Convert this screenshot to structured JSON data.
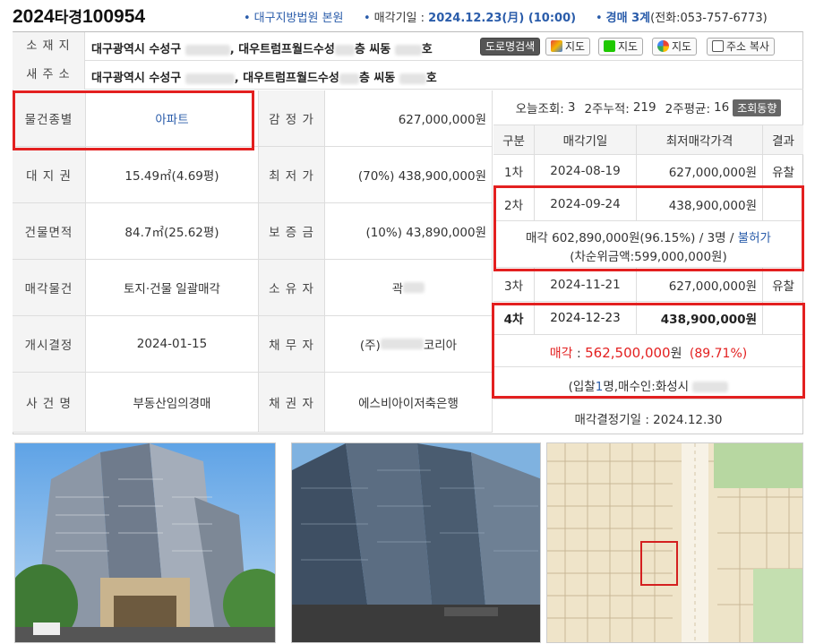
{
  "header": {
    "case_year": "2024",
    "case_kind": "타경",
    "case_num": "100954",
    "court": "대구지방법원 본원",
    "sale_date_label": "매각기일 : ",
    "sale_date": "2024.12.23(月) (10:00)",
    "dept": "경매 3계",
    "phone": "(전화:053-757-6773)"
  },
  "address": {
    "location_label": "소 재 지",
    "location_part1": "대구광역시 수성구",
    "location_part2": ", 대우트럼프월드수성",
    "location_part3": "층 씨동",
    "location_part4": "호",
    "new_label": "새 주 소",
    "new_part1": "대구광역시 수성구",
    "new_part2": ", 대우트럼프월드수성",
    "new_part3": "층 씨동",
    "new_part4": "호",
    "buttons": {
      "road": "도로명검색",
      "daum": "지도",
      "naver": "지도",
      "google": "지도",
      "copy": "주소 복사"
    }
  },
  "info": {
    "type_label": "물건종별",
    "type_value": "아파트",
    "appraisal_label": "감 정 가",
    "appraisal_value": "627,000,000원",
    "land_label": "대 지 권",
    "land_value": "15.49㎡(4.69평)",
    "min_label": "최 저 가",
    "min_value": "(70%) 438,900,000원",
    "area_label": "건물면적",
    "area_value": "84.7㎡(25.62평)",
    "deposit_label": "보 증 금",
    "deposit_value": "(10%) 43,890,000원",
    "item_label": "매각물건",
    "item_value": "토지·건물 일괄매각",
    "owner_label": "소 유 자",
    "owner_value": "곽",
    "start_label": "개시결정",
    "start_value": "2024-01-15",
    "debtor_label": "채 무 자",
    "debtor_prefix": "(주)",
    "debtor_suffix": "코리아",
    "case_label": "사 건 명",
    "case_value": "부동산임의경매",
    "creditor_label": "채 권 자",
    "creditor_value": "에스비아이저축은행"
  },
  "stats": {
    "today_label": "오늘조회: ",
    "today": "3",
    "week2_label": "2주누적: ",
    "week2": "219",
    "avg_label": "2주평균: ",
    "avg": "16",
    "trend_button": "조회동향"
  },
  "history": {
    "headers": [
      "구분",
      "매각기일",
      "최저매각가격",
      "결과"
    ],
    "rounds": [
      {
        "round": "1차",
        "date": "2024-08-19",
        "price": "627,000,000원",
        "result": "유찰"
      },
      {
        "round": "2차",
        "date": "2024-09-24",
        "price": "438,900,000원",
        "result": ""
      },
      {
        "round": "3차",
        "date": "2024-11-21",
        "price": "627,000,000원",
        "result": "유찰"
      },
      {
        "round": "4차",
        "date": "2024-12-23",
        "price": "438,900,000원",
        "result": ""
      }
    ],
    "round2_sale_prefix": "매각 602,890,000원(96.15%) / 3명 / ",
    "round2_sale_link": "불허가",
    "round2_second": "(차순위금액:599,000,000원)",
    "round4_sale_label": "매각",
    "round4_sale_sep": " : ",
    "round4_sale_price": "562,500,000",
    "round4_sale_unit": "원",
    "round4_sale_pct": "(89.71%)",
    "round4_bid_pre": "(입찰",
    "round4_bid_count": "1",
    "round4_bid_post": "명,매수인:화성시",
    "decision": "매각결정기일 : 2024.12.30"
  },
  "colors": {
    "accent": "#2a5caa",
    "highlight": "#e32020"
  }
}
